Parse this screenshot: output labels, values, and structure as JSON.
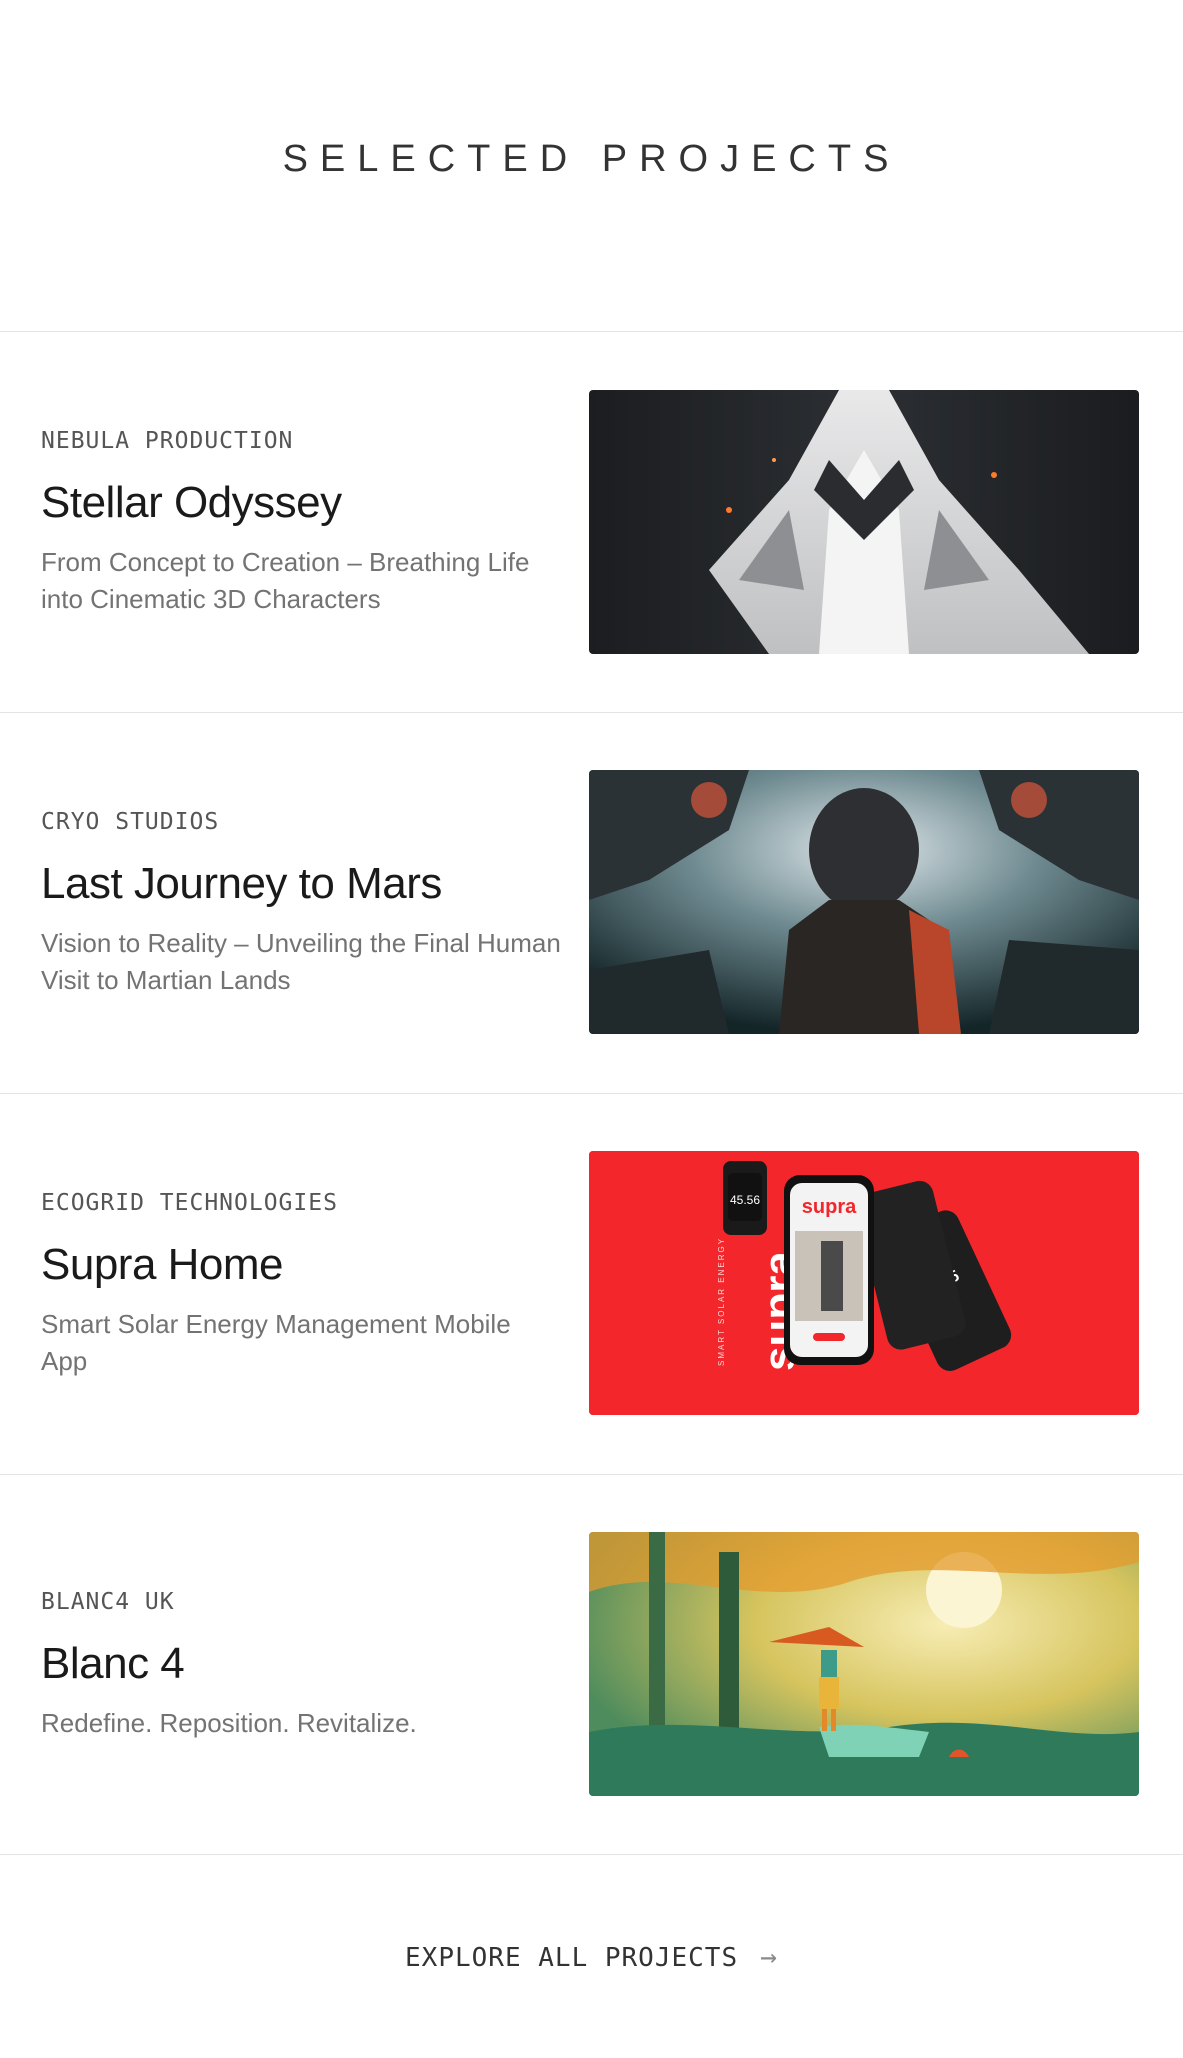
{
  "header": {
    "title": "SELECTED PROJECTS"
  },
  "projects": [
    {
      "client": "NEBULA PRODUCTION",
      "title": "Stellar Odyssey",
      "description": "From Concept to Creation – Breathing Life into Cinematic 3D Characters",
      "image_alt": "white armored humanoid character render"
    },
    {
      "client": "CRYO STUDIOS",
      "title": "Last Journey to Mars",
      "description": "Vision to Reality – Unveiling the Final Human Visit to Martian Lands",
      "image_alt": "astronaut among floating spaceships"
    },
    {
      "client": "ECOGRID TECHNOLOGIES",
      "title": "Supra Home",
      "description": "Smart Solar Energy Management Mobile App",
      "image_alt": "supra app mockups on red background",
      "image_text": {
        "brand": "supra",
        "tagline": "SMART SOLAR ENERGY",
        "watch_value": "45.56",
        "phone_value": "3.65"
      }
    },
    {
      "client": "BLANC4 UK",
      "title": "Blanc 4",
      "description": "Redefine. Reposition. Revitalize.",
      "image_alt": "illustrated child in forest with hat"
    }
  ],
  "footer": {
    "explore_label": "EXPLORE ALL PROJECTS",
    "arrow_icon": "arrow-right-icon"
  },
  "colors": {
    "supra_red": "#f2262b",
    "divider": "#e4e4e4"
  }
}
